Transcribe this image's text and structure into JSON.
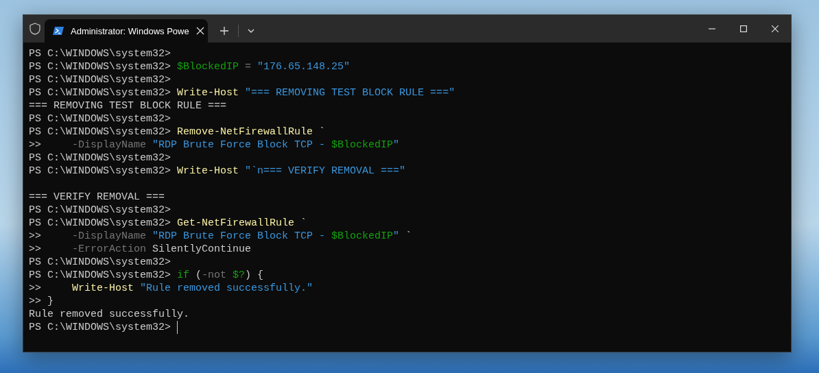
{
  "window": {
    "tab": {
      "title": "Administrator: Windows Powe",
      "selected": true
    }
  },
  "terminal": {
    "lines": [
      {
        "segments": [
          {
            "kind": "prompt",
            "text": "PS C:\\WINDOWS\\system32>"
          }
        ]
      },
      {
        "segments": [
          {
            "kind": "prompt",
            "text": "PS C:\\WINDOWS\\system32> "
          },
          {
            "kind": "variable",
            "text": "$BlockedIP"
          },
          {
            "kind": "operator",
            "text": " = "
          },
          {
            "kind": "string",
            "text": "\"176.65.148.25\""
          }
        ]
      },
      {
        "segments": [
          {
            "kind": "prompt",
            "text": "PS C:\\WINDOWS\\system32>"
          }
        ]
      },
      {
        "segments": [
          {
            "kind": "prompt",
            "text": "PS C:\\WINDOWS\\system32> "
          },
          {
            "kind": "command",
            "text": "Write-Host "
          },
          {
            "kind": "string",
            "text": "\"=== REMOVING TEST BLOCK RULE ===\""
          }
        ]
      },
      {
        "segments": [
          {
            "kind": "plain",
            "text": "=== REMOVING TEST BLOCK RULE ==="
          }
        ]
      },
      {
        "segments": [
          {
            "kind": "prompt",
            "text": "PS C:\\WINDOWS\\system32>"
          }
        ]
      },
      {
        "segments": [
          {
            "kind": "prompt",
            "text": "PS C:\\WINDOWS\\system32> "
          },
          {
            "kind": "command",
            "text": "Remove-NetFirewallRule"
          },
          {
            "kind": "plain",
            "text": " `"
          }
        ]
      },
      {
        "segments": [
          {
            "kind": "prompt",
            "text": ">>     "
          },
          {
            "kind": "parameter",
            "text": "-DisplayName "
          },
          {
            "kind": "string",
            "text": "\"RDP Brute Force Block TCP - "
          },
          {
            "kind": "variable",
            "text": "$BlockedIP"
          },
          {
            "kind": "string",
            "text": "\""
          }
        ]
      },
      {
        "segments": [
          {
            "kind": "prompt",
            "text": "PS C:\\WINDOWS\\system32>"
          }
        ]
      },
      {
        "segments": [
          {
            "kind": "prompt",
            "text": "PS C:\\WINDOWS\\system32> "
          },
          {
            "kind": "command",
            "text": "Write-Host "
          },
          {
            "kind": "string",
            "text": "\"`n=== VERIFY REMOVAL ===\""
          }
        ]
      },
      {
        "blank_before": true,
        "segments": [
          {
            "kind": "plain",
            "text": "=== VERIFY REMOVAL ==="
          }
        ]
      },
      {
        "segments": [
          {
            "kind": "prompt",
            "text": "PS C:\\WINDOWS\\system32>"
          }
        ]
      },
      {
        "segments": [
          {
            "kind": "prompt",
            "text": "PS C:\\WINDOWS\\system32> "
          },
          {
            "kind": "command",
            "text": "Get-NetFirewallRule"
          },
          {
            "kind": "plain",
            "text": " `"
          }
        ]
      },
      {
        "segments": [
          {
            "kind": "prompt",
            "text": ">>     "
          },
          {
            "kind": "parameter",
            "text": "-DisplayName "
          },
          {
            "kind": "string",
            "text": "\"RDP Brute Force Block TCP - "
          },
          {
            "kind": "variable",
            "text": "$BlockedIP"
          },
          {
            "kind": "string",
            "text": "\""
          },
          {
            "kind": "plain",
            "text": " `"
          }
        ]
      },
      {
        "segments": [
          {
            "kind": "prompt",
            "text": ">>     "
          },
          {
            "kind": "parameter",
            "text": "-ErrorAction"
          },
          {
            "kind": "plain",
            "text": " SilentlyContinue"
          }
        ]
      },
      {
        "segments": [
          {
            "kind": "prompt",
            "text": "PS C:\\WINDOWS\\system32>"
          }
        ]
      },
      {
        "segments": [
          {
            "kind": "prompt",
            "text": "PS C:\\WINDOWS\\system32> "
          },
          {
            "kind": "keyword",
            "text": "if"
          },
          {
            "kind": "plain",
            "text": " ("
          },
          {
            "kind": "operator",
            "text": "-not "
          },
          {
            "kind": "variable",
            "text": "$?"
          },
          {
            "kind": "plain",
            "text": ") {"
          }
        ]
      },
      {
        "segments": [
          {
            "kind": "prompt",
            "text": ">>     "
          },
          {
            "kind": "command",
            "text": "Write-Host "
          },
          {
            "kind": "string",
            "text": "\"Rule removed successfully.\""
          }
        ]
      },
      {
        "segments": [
          {
            "kind": "prompt",
            "text": ">> }"
          }
        ]
      },
      {
        "segments": [
          {
            "kind": "plain",
            "text": "Rule removed successfully."
          }
        ]
      },
      {
        "cursor": true,
        "segments": [
          {
            "kind": "prompt",
            "text": "PS C:\\WINDOWS\\system32> "
          }
        ]
      }
    ]
  }
}
